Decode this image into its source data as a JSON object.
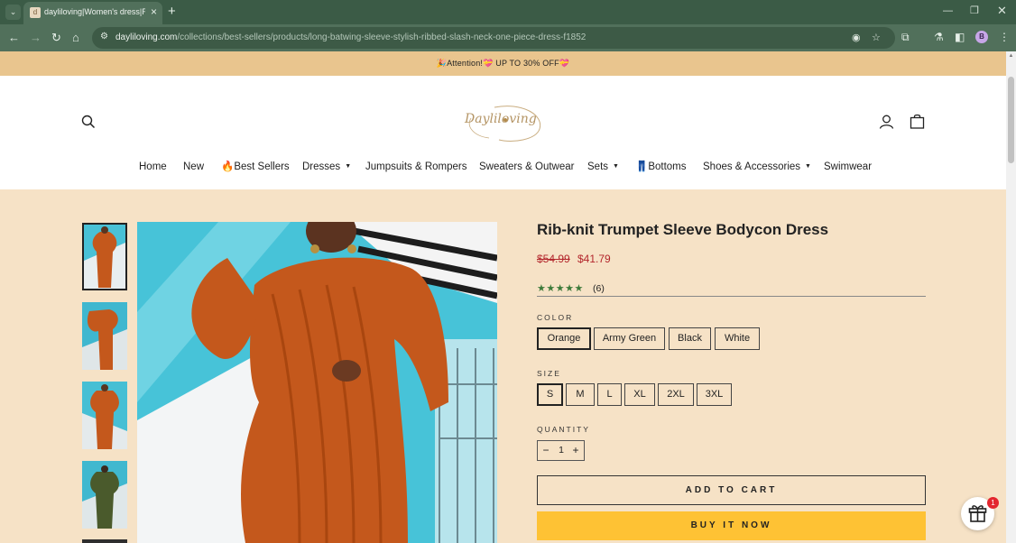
{
  "browser": {
    "tab_title": "dayliloving|Women's dress|Rib-knit",
    "url_host": "dayliloving.com",
    "url_path": "/collections/best-sellers/products/long-batwing-sleeve-stylish-ribbed-slash-neck-one-piece-dress-f1852",
    "profile_initial": "B"
  },
  "announcement": "🎉Attention!💝 UP TO 30% OFF💝",
  "logo_text": "Dayliloving",
  "nav": {
    "home": "Home",
    "new": "New",
    "best_sellers": "🔥Best Sellers",
    "dresses": "Dresses",
    "jumpsuits": "Jumpsuits & Rompers",
    "sweaters": "Sweaters & Outwear",
    "sets": "Sets",
    "bottoms": "👖Bottoms",
    "shoes": "Shoes & Accessories",
    "swimwear": "Swimwear"
  },
  "product": {
    "title": "Rib-knit Trumpet Sleeve Bodycon Dress",
    "price_old": "$54.99",
    "price_new": "$41.79",
    "stars": "★★★★★",
    "rating": 5,
    "review_count": "(6)",
    "color_label": "COLOR",
    "colors": [
      "Orange",
      "Army Green",
      "Black",
      "White"
    ],
    "color_selected": "Orange",
    "size_label": "SIZE",
    "sizes": [
      "S",
      "M",
      "L",
      "XL",
      "2XL",
      "3XL"
    ],
    "size_selected": "S",
    "quantity_label": "QUANTITY",
    "quantity": "1",
    "add_to_cart": "ADD TO CART",
    "buy_now": "BUY IT NOW"
  },
  "gift_badge": "1",
  "colors": {
    "announcement_bg": "#e9c58e",
    "page_bg": "#f6e2c6",
    "price": "#b3262c",
    "buy_now_bg": "#fec234",
    "dress_orange": "#c4581c",
    "photo_bg": "#47c3d8"
  }
}
